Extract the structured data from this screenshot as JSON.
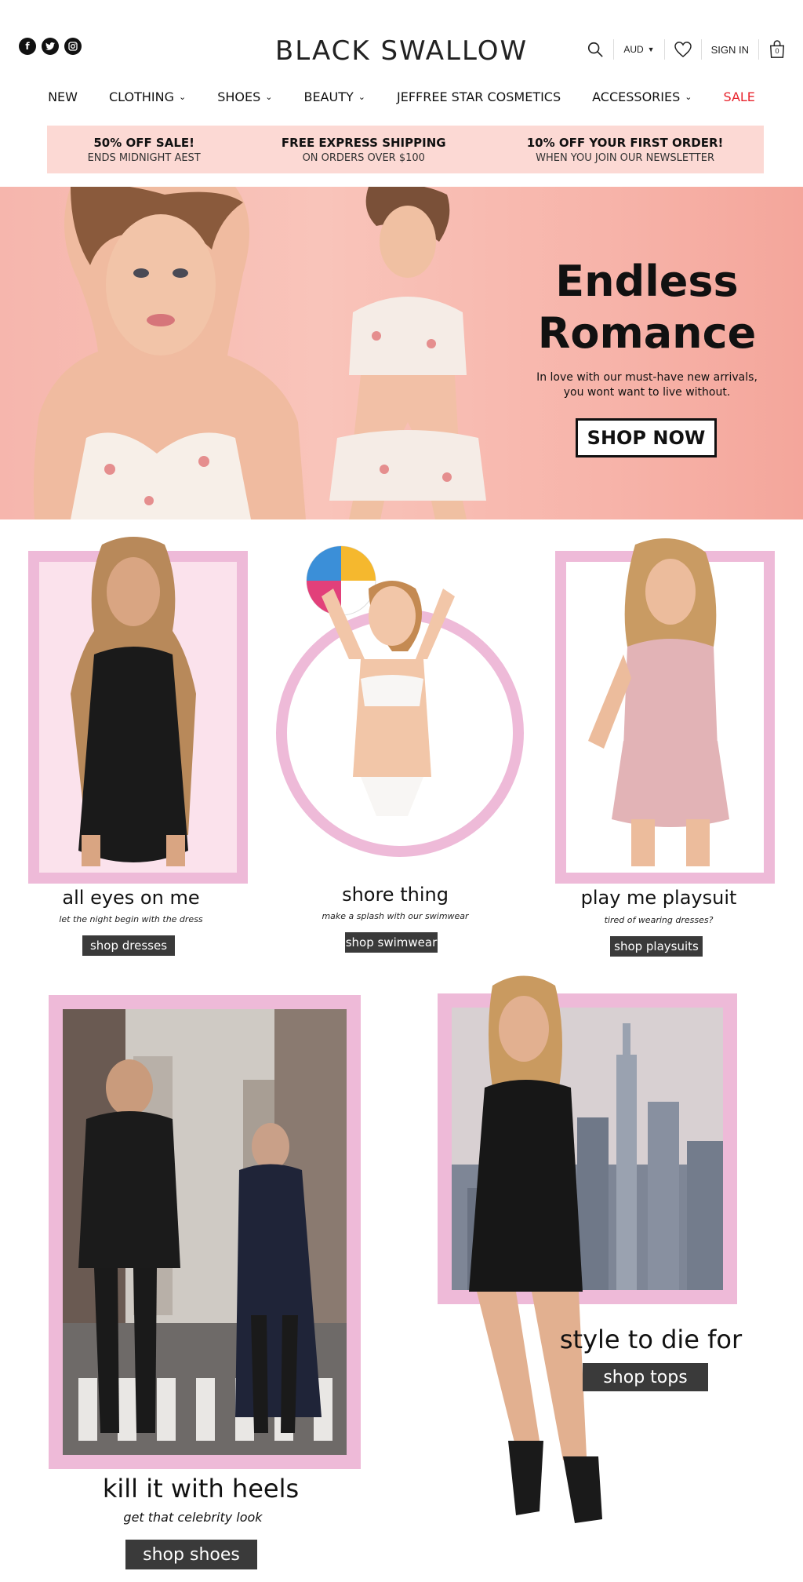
{
  "brand": {
    "logo": "BLACK SWALLOW"
  },
  "social": [
    {
      "icon": "facebook-icon",
      "glyph": "f"
    },
    {
      "icon": "twitter-icon",
      "glyph": "t"
    },
    {
      "icon": "instagram-icon",
      "glyph": "◎"
    }
  ],
  "utility": {
    "currency": "AUD",
    "sign_in": "SIGN IN",
    "cart_count": "0"
  },
  "nav": {
    "items": [
      {
        "label": "NEW"
      },
      {
        "label": "CLOTHING",
        "chevron": "⌄"
      },
      {
        "label": "SHOES",
        "chevron": "⌄"
      },
      {
        "label": "BEAUTY",
        "chevron": "⌄"
      },
      {
        "label": "JEFFREE STAR COSMETICS"
      },
      {
        "label": "ACCESSORIES",
        "chevron": "⌄"
      },
      {
        "label": "SALE"
      }
    ],
    "sale_color": "#e8232c"
  },
  "promo": [
    {
      "title": "50% OFF SALE!",
      "sub": "ENDS MIDNIGHT AEST"
    },
    {
      "title": "FREE EXPRESS SHIPPING",
      "sub": "ON ORDERS OVER $100"
    },
    {
      "title": "10% OFF YOUR FIRST ORDER!",
      "sub": "WHEN YOU JOIN OUR NEWSLETTER"
    }
  ],
  "hero": {
    "title_line1": "Endless",
    "title_line2": "Romance",
    "sub_line1": "In love with our must-have new arrivals,",
    "sub_line2": "you wont want to live without.",
    "cta": "SHOP NOW"
  },
  "cards": [
    {
      "title": "all eyes on me",
      "sub": "let the night begin with the dress",
      "cta": "shop dresses"
    },
    {
      "title": "shore thing",
      "sub": "make a splash with our swimwear",
      "cta": "shop swimwear"
    },
    {
      "title": "play me playsuit",
      "sub": "tired of wearing dresses?",
      "cta": "shop playsuits"
    }
  ],
  "features": [
    {
      "title": "kill it with heels",
      "sub": "get that celebrity look",
      "cta": "shop shoes"
    },
    {
      "title": "style to die for",
      "cta": "shop tops"
    }
  ],
  "colors": {
    "accent_pink": "#eebad8",
    "promo_bg": "#fcd9d4",
    "hero_bg": "#f8bdb3",
    "button_dark": "#3a3a3a"
  }
}
